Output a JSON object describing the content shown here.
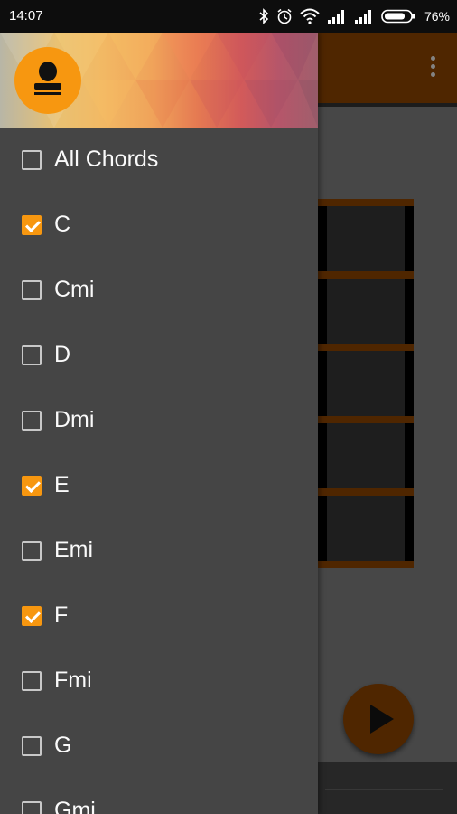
{
  "status_bar": {
    "time": "14:07",
    "battery": "76%",
    "icons": [
      "bluetooth-icon",
      "alarm-icon",
      "wifi-icon",
      "signal-icon",
      "signal-icon",
      "battery-icon"
    ]
  },
  "colors": {
    "accent": "#f79710",
    "drawer_bg": "#454545",
    "app_bar": "#7a3b00",
    "checkbox_border": "#c8c8c8"
  },
  "drawer": {
    "items": [
      {
        "label": "All Chords",
        "checked": false
      },
      {
        "label": "C",
        "checked": true
      },
      {
        "label": "Cmi",
        "checked": false
      },
      {
        "label": "D",
        "checked": false
      },
      {
        "label": "Dmi",
        "checked": false
      },
      {
        "label": "E",
        "checked": true
      },
      {
        "label": "Emi",
        "checked": false
      },
      {
        "label": "F",
        "checked": true
      },
      {
        "label": "Fmi",
        "checked": false
      },
      {
        "label": "G",
        "checked": false
      },
      {
        "label": "Gmi",
        "checked": false
      }
    ]
  },
  "app": {
    "overflow_icon": "more-vert-icon",
    "play_icon": "play-icon"
  }
}
